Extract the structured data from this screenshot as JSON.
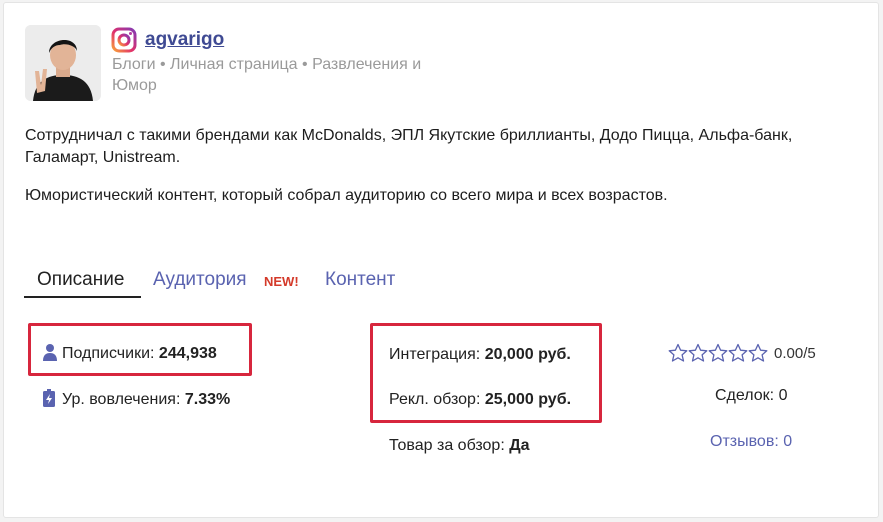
{
  "profile": {
    "username": "agvarigo",
    "categories": "Блоги • Личная страница • Развлечения и Юмор"
  },
  "description": {
    "brands": "Сотрудничал с такими брендами как McDonalds, ЭПЛ Якутские бриллианты, Додо Пицца, Альфа-банк, Галамарт, Unistream.",
    "content": "Юмористический контент, который собрал аудиторию со всего мира и всех возрастов."
  },
  "tabs": {
    "description": "Описание",
    "audience": "Аудитория",
    "audience_badge": "NEW!",
    "content": "Контент"
  },
  "stats": {
    "subscribers_label": "Подписчики:",
    "subscribers_value": "244,938",
    "engagement_label": "Ур. вовлечения:",
    "engagement_value": "7.33%",
    "integration_label": "Интеграция:",
    "integration_value": "20,000 руб.",
    "review_label": "Рекл. обзор:",
    "review_value": "25,000 руб.",
    "product_label": "Товар за обзор:",
    "product_value": "Да"
  },
  "rating": {
    "value": "0.00/5",
    "stars_filled": 0,
    "stars_total": 5,
    "deals": "Сделок: 0",
    "reviews": "Отзывов: 0"
  },
  "colors": {
    "accent": "#5a63b0",
    "highlight_border": "#d7263d",
    "new_badge": "#d43a2a",
    "muted_text": "#9a9a9a"
  }
}
